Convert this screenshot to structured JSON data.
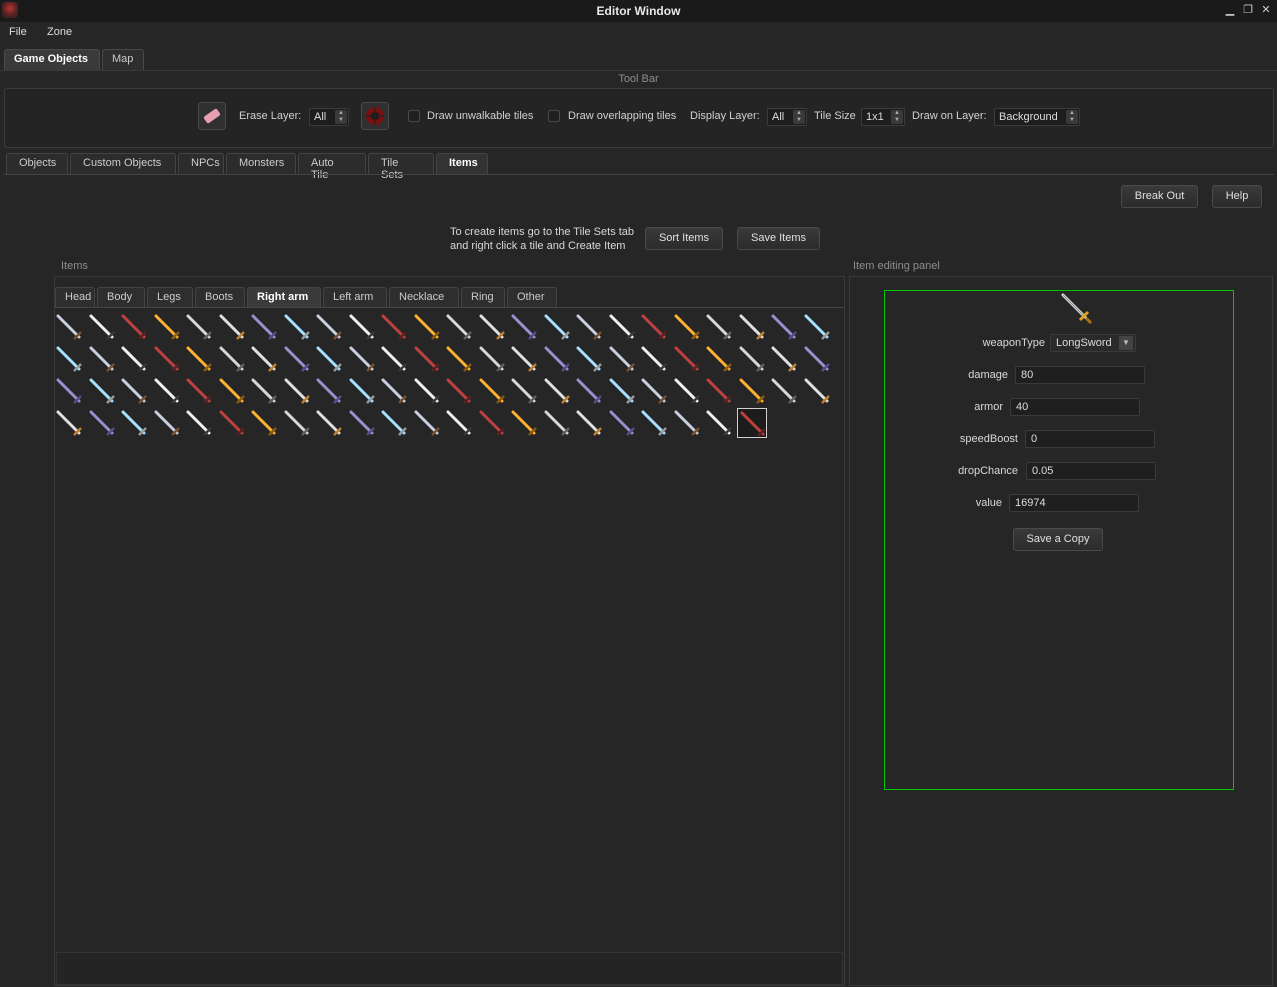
{
  "window": {
    "title": "Editor Window",
    "controls": [
      "minimize-icon",
      "restore-icon",
      "close-icon"
    ]
  },
  "menu": {
    "file": "File",
    "zone": "Zone"
  },
  "top_tabs": [
    {
      "label": "Game Objects",
      "active": true
    },
    {
      "label": "Map",
      "active": false
    }
  ],
  "toolbar": {
    "title": "Tool Bar",
    "erase_layer_label": "Erase Layer:",
    "erase_layer_value": "All",
    "draw_unwalkable_label": "Draw unwalkable tiles",
    "draw_overlapping_label": "Draw overlapping tiles",
    "display_layer_label": "Display Layer:",
    "display_layer_value": "All",
    "tile_size_label": "Tile Size",
    "tile_size_value": "1x1",
    "draw_on_layer_label": "Draw on Layer:",
    "draw_on_layer_value": "Background"
  },
  "second_tabs": [
    "Objects",
    "Custom Objects",
    "NPCs",
    "Monsters",
    "Auto Tile",
    "Tile Sets",
    "Items"
  ],
  "second_tab_active": "Items",
  "buttons": {
    "break_out": "Break Out",
    "help": "Help",
    "sort_items": "Sort Items",
    "save_items": "Save Items",
    "save_copy": "Save a Copy"
  },
  "hint": {
    "line1": "To create items go to the Tile Sets tab",
    "line2": "and right click a tile and Create Item"
  },
  "items": {
    "title": "Items",
    "tabs": [
      "Head",
      "Body",
      "Legs",
      "Boots",
      "Right arm",
      "Left arm",
      "Necklace",
      "Ring",
      "Other"
    ],
    "active_tab": "Right arm",
    "icon_count": 94,
    "selected_index": 93
  },
  "panel": {
    "title": "Item editing panel",
    "fields": {
      "weaponType": {
        "label": "weaponType",
        "value": "LongSword"
      },
      "damage": {
        "label": "damage",
        "value": "80"
      },
      "armor": {
        "label": "armor",
        "value": "40"
      },
      "speedBoost": {
        "label": "speedBoost",
        "value": "0"
      },
      "dropChance": {
        "label": "dropChance",
        "value": "0.05"
      },
      "value": {
        "label": "value",
        "value": "16974"
      }
    }
  },
  "colors": {
    "accent_border": "#00c800",
    "background": "#262626"
  }
}
